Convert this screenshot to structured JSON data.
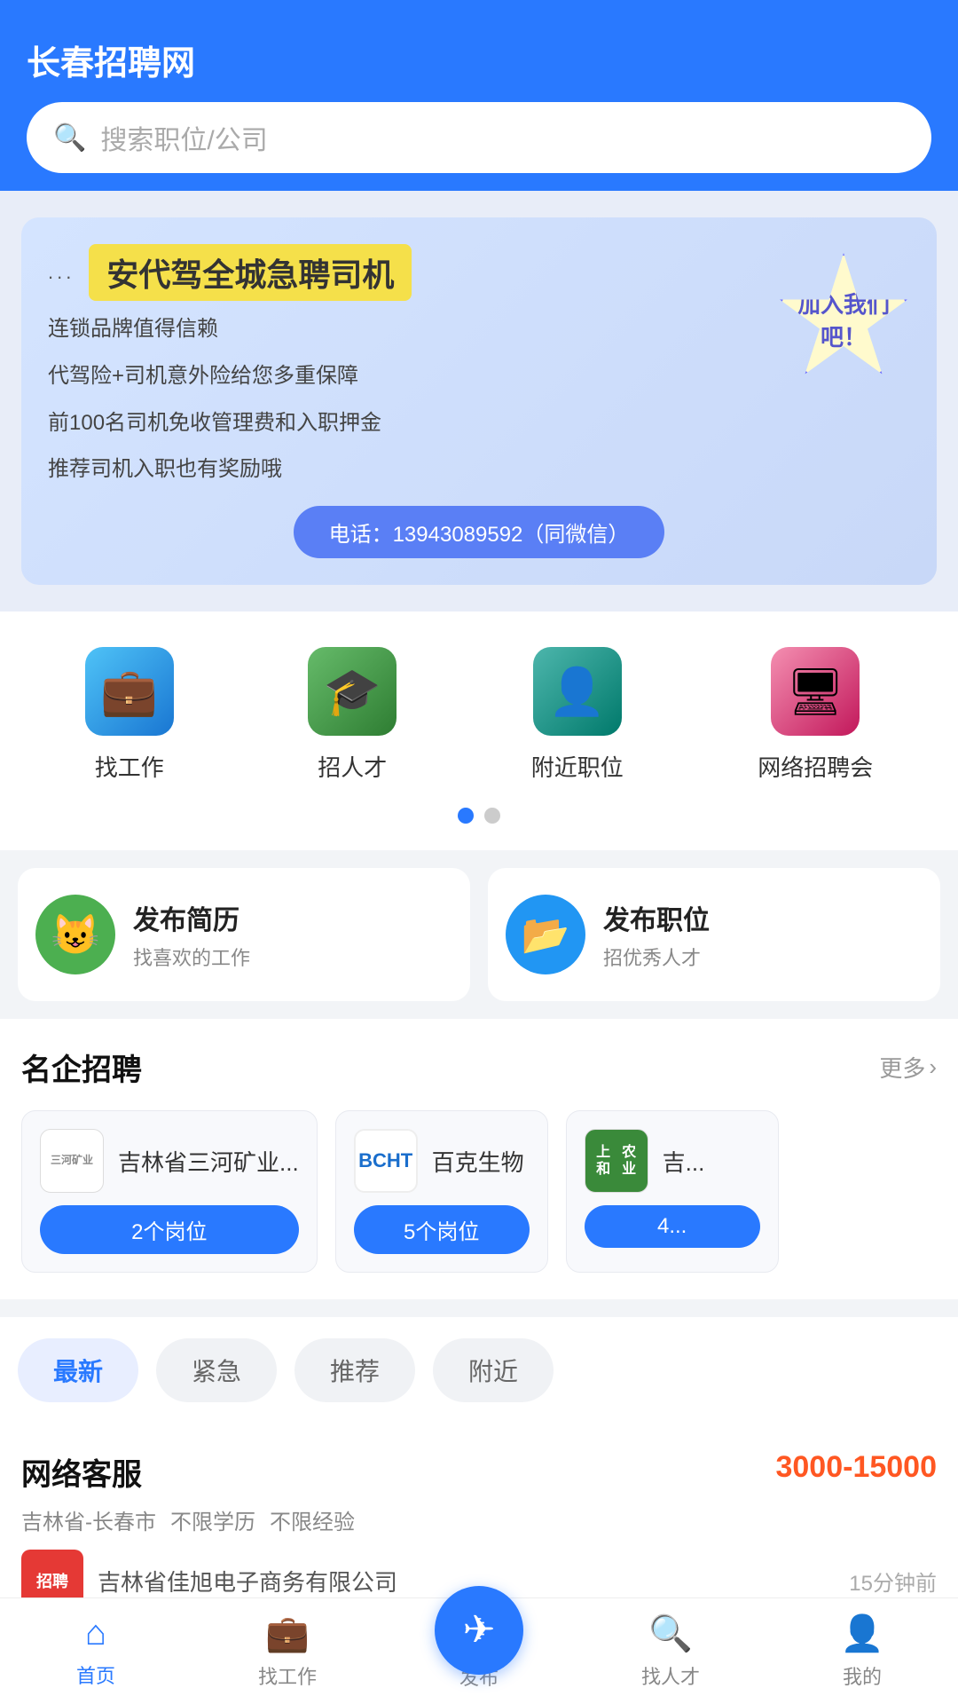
{
  "app": {
    "title": "长春招聘网"
  },
  "header": {
    "title": "长春招聘网",
    "search_placeholder": "搜索职位/公司"
  },
  "banner": {
    "dots": "...",
    "title": "安代驾全城急聘司机",
    "lines": [
      "连锁品牌值得信赖",
      "代驾险+司机意外险给您多重保障",
      "前100名司机免收管理费和入职押金",
      "推荐司机入职也有奖励哦"
    ],
    "phone": "电话：13943089592（同微信）",
    "badge": "加入我们吧！"
  },
  "quick_menu": {
    "items": [
      {
        "id": "find-job",
        "label": "找工作",
        "icon": "💼"
      },
      {
        "id": "recruit",
        "label": "招人才",
        "icon": "🎓"
      },
      {
        "id": "nearby",
        "label": "附近职位",
        "icon": "👤"
      },
      {
        "id": "fair",
        "label": "网络招聘会",
        "icon": "🖥"
      }
    ],
    "dots": [
      true,
      false
    ]
  },
  "action_cards": [
    {
      "id": "post-resume",
      "icon": "😺",
      "title": "发布简历",
      "subtitle": "找喜欢的工作"
    },
    {
      "id": "post-job",
      "icon": "📂",
      "title": "发布职位",
      "subtitle": "招优秀人才"
    }
  ],
  "famous_companies": {
    "section_title": "名企招聘",
    "more_label": "更多",
    "companies": [
      {
        "id": "sanhe",
        "logo_text": "三河矿业",
        "name": "吉林省三河矿业...",
        "positions": "2个岗位"
      },
      {
        "id": "bcht",
        "logo_text": "BCHT",
        "name": "百克生物",
        "positions": "5个岗位"
      },
      {
        "id": "shanghe",
        "logo_text": "上和农业",
        "name": "吉...",
        "positions": "4..."
      }
    ]
  },
  "filter_tabs": {
    "tabs": [
      {
        "id": "newest",
        "label": "最新",
        "active": true
      },
      {
        "id": "urgent",
        "label": "紧急",
        "active": false
      },
      {
        "id": "recommended",
        "label": "推荐",
        "active": false
      },
      {
        "id": "nearby",
        "label": "附近",
        "active": false
      }
    ]
  },
  "job_listings": [
    {
      "id": "job-1",
      "title": "网络客服",
      "salary": "3000-15000",
      "tags": [
        "吉林省-长春市",
        "不限学历",
        "不限经验"
      ],
      "company_name": "吉林省佳旭电子商务有限公司",
      "company_thumb": "招聘",
      "time_ago": "15分钟前"
    }
  ],
  "bottom_nav": {
    "items": [
      {
        "id": "home",
        "label": "首页",
        "icon": "⌂",
        "active": true
      },
      {
        "id": "find-work",
        "label": "找工作",
        "icon": "💼",
        "active": false
      },
      {
        "id": "publish",
        "label": "发布",
        "icon": "✈",
        "active": false,
        "special": true
      },
      {
        "id": "find-talent",
        "label": "找人才",
        "icon": "🔍",
        "active": false
      },
      {
        "id": "mine",
        "label": "我的",
        "icon": "👤",
        "active": false
      }
    ]
  }
}
